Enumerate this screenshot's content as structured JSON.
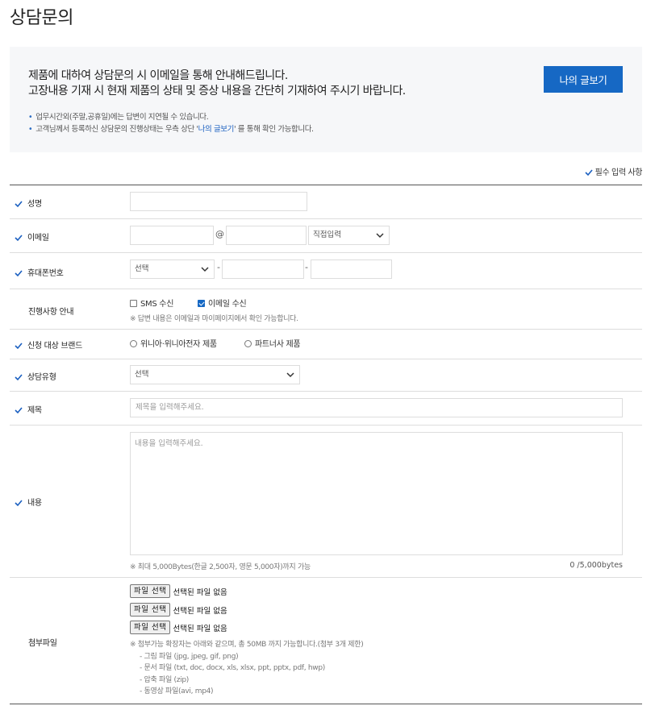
{
  "page": {
    "title": "상담문의"
  },
  "notice": {
    "line1": "제품에 대하여 상담문의 시 이메일을 통해 안내해드립니다.",
    "line2": "고장내용 기재 시 현재 제품의 상태 및 증상 내용을 간단히 기재하여 주시기 바랍니다.",
    "bullet1": "업무시간외(주말,공휴일)에는 답변이 지연될 수 있습니다.",
    "bullet2_pre": "고객님께서 등록하신 상담문의 진행상태는 우측 상단 '",
    "bullet2_link": "나의 글보기",
    "bullet2_post": "' 를 통해 확인 가능합니다.",
    "my_posts_button": "나의 글보기"
  },
  "form": {
    "required_note": "필수 입력 사항",
    "name": {
      "label": "성명",
      "value": ""
    },
    "email": {
      "label": "이메일",
      "at": "@",
      "domain_select": "직접입력"
    },
    "phone": {
      "label": "휴대폰번호",
      "prefix_select": "선택",
      "dash": "-"
    },
    "progress": {
      "label": "진행사항 안내",
      "sms_label": "SMS 수신",
      "sms_checked": false,
      "email_label": "이메일 수신",
      "email_checked": true,
      "hint": "※ 답변 내용은 이메일과 마이페이지에서 확인 가능합니다."
    },
    "brand": {
      "label": "신청 대상 브랜드",
      "option1": "위니아·위니아전자 제품",
      "option2": "파트너사 제품"
    },
    "type": {
      "label": "상담유형",
      "select": "선택"
    },
    "subject": {
      "label": "제목",
      "placeholder": "제목을 입력해주세요."
    },
    "content": {
      "label": "내용",
      "placeholder": "내용을 입력해주세요.",
      "limit_hint": "※ 최대 5,000Bytes(한글 2,500자, 영문 5,000자)까지 가능",
      "counter": "0 /5,000bytes"
    },
    "attachment": {
      "label": "첨부파일",
      "button": "파일 선택",
      "no_file": "선택된 파일 없음",
      "guide_main": "※ 첨부가능 확장자는 아래와 같으며, 총 50MB 까지 가능합니다.(첨부 3개 제한)",
      "guide_image": "- 그림 파일 (jpg, jpeg, gif, png)",
      "guide_doc": "- 문서 파일 (txt, doc, docx, xls, xlsx, ppt, pptx, pdf, hwp)",
      "guide_zip": "- 압축 파일 (zip)",
      "guide_video": "- 동영상 파일(avi, mp4)"
    }
  },
  "colors": {
    "accent": "#1668c4",
    "check": "#1a5fc0",
    "notice_bg": "#f6f7f9"
  }
}
